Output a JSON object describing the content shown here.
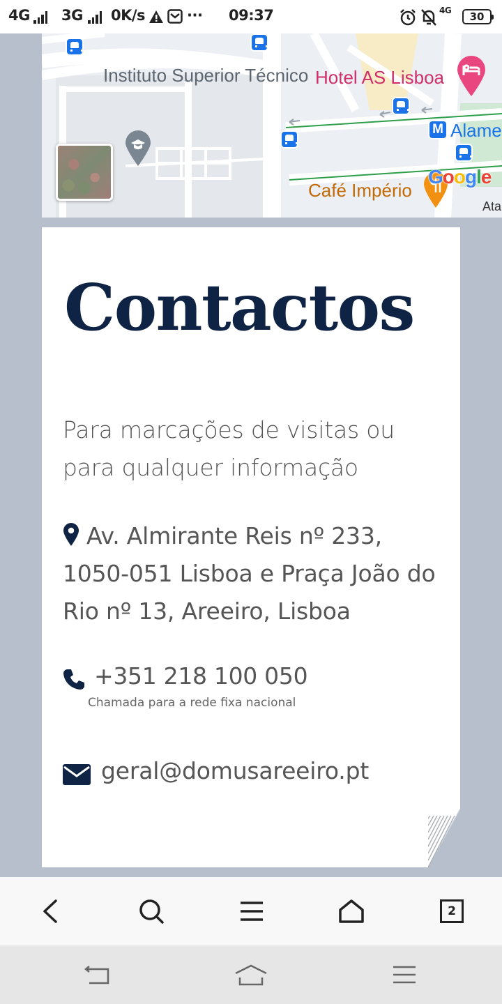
{
  "status_bar": {
    "network_1": "4G",
    "network_2": "3G",
    "speed": "0K/s",
    "more": "···",
    "time": "09:37",
    "network_3": "4G",
    "battery": "30"
  },
  "map": {
    "labels": {
      "institute": "Instituto Superior Técnico",
      "hotel": "Hotel AS Lisboa",
      "metro_station": "Alame",
      "cafe": "Café Império",
      "edge_label": "Ata"
    },
    "metro_letter": "M",
    "google_logo": "Google"
  },
  "contact": {
    "title": "Contactos",
    "intro": "Para marcações de visitas ou para qualquer informação",
    "address": "Av. Almirante Reis nº 233, 1050-051 Lisboa e Praça João do Rio nº 13, Areeiro, Lisboa",
    "phone": "+351 218 100 050",
    "phone_note": "Chamada para a rede fixa nacional",
    "email": "geral@domusareeiro.pt"
  },
  "toolbar": {
    "tabs_count": "2"
  },
  "colors": {
    "page_background": "#b6bfcb",
    "title_navy": "#0f2344",
    "hotel_pink": "#d02e6b",
    "transit_blue": "#1a73e8",
    "cafe_orange": "#c36a08"
  }
}
